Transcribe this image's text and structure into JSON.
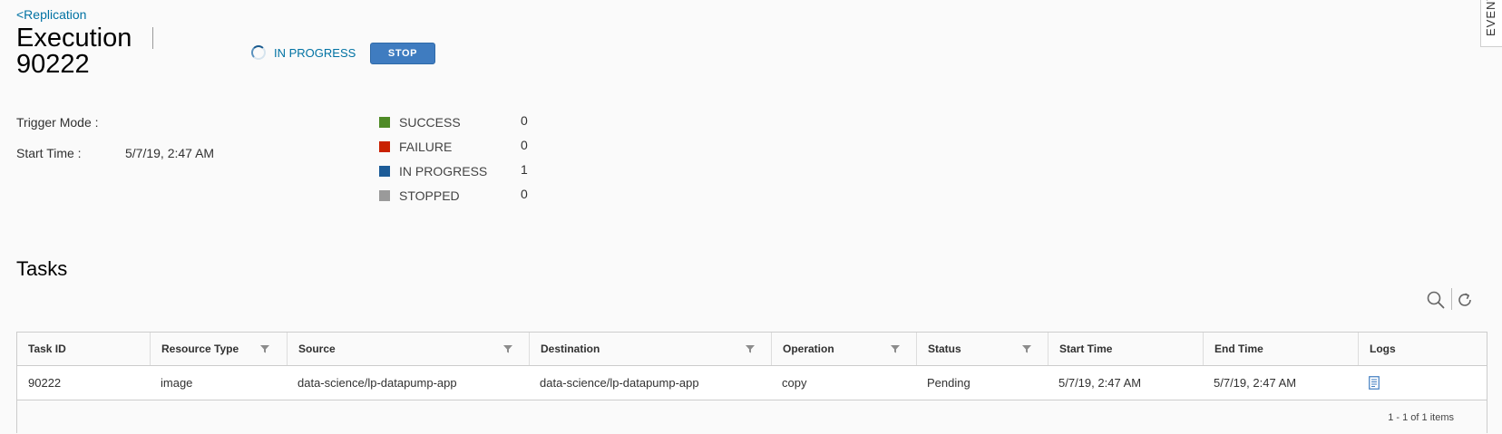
{
  "header": {
    "back_label": "<Replication",
    "title_line1": "Execution",
    "title_line2": "90222",
    "status_text": "IN PROGRESS",
    "stop_label": "STOP"
  },
  "info": {
    "trigger_mode_label": "Trigger Mode :",
    "trigger_mode_value": "",
    "start_time_label": "Start Time :",
    "start_time_value": "5/7/19, 2:47 AM"
  },
  "stats": [
    {
      "label": "SUCCESS",
      "value": "0",
      "color": "#4e8a26"
    },
    {
      "label": "FAILURE",
      "value": "0",
      "color": "#c92100"
    },
    {
      "label": "IN PROGRESS",
      "value": "1",
      "color": "#1d5c98"
    },
    {
      "label": "STOPPED",
      "value": "0",
      "color": "#9a9a9a"
    }
  ],
  "tasks": {
    "title": "Tasks",
    "columns": [
      "Task ID",
      "Resource Type",
      "Source",
      "Destination",
      "Operation",
      "Status",
      "Start Time",
      "End Time",
      "Logs"
    ],
    "rows": [
      {
        "task_id": "90222",
        "resource_type": "image",
        "source": "data-science/lp-datapump-app",
        "destination": "data-science/lp-datapump-app",
        "operation": "copy",
        "status": "Pending",
        "start_time": "5/7/19, 2:47 AM",
        "end_time": "5/7/19, 2:47 AM"
      }
    ],
    "pagination": "1 - 1 of 1 items"
  },
  "side_tab": {
    "label": "EVENTS"
  },
  "icons": {
    "search": "search-icon",
    "refresh": "refresh-icon",
    "filter": "filter-icon",
    "log": "log-file-icon",
    "spinner": "spinner-icon"
  }
}
